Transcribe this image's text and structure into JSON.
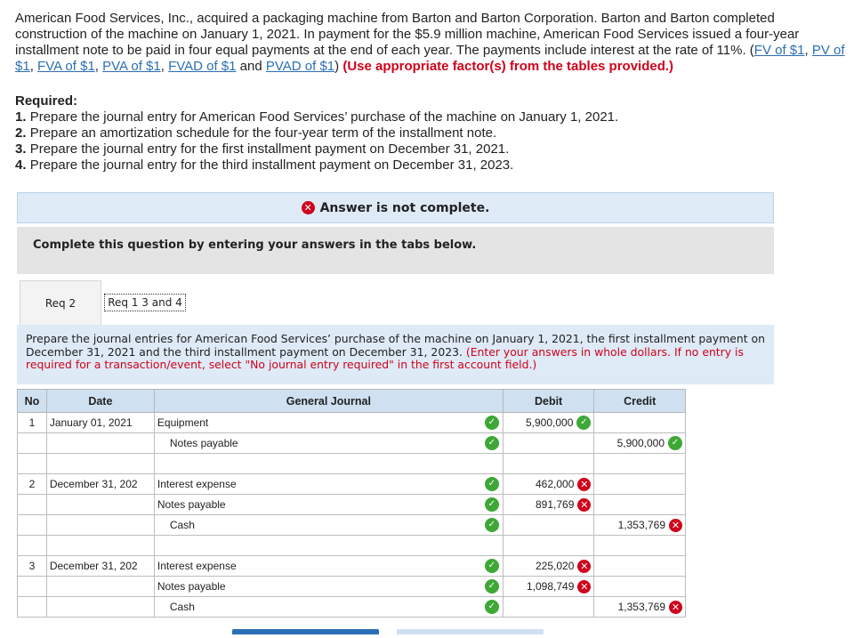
{
  "problem": {
    "text": "American Food Services, Inc., acquired a packaging machine from Barton and Barton Corporation. Barton and Barton completed construction of the machine on January 1, 2021. In payment for the $5.9 million machine, American Food Services issued a four-year installment note to be paid in four equal payments at the end of each year. The payments include interest at the rate of 11%. (",
    "links": [
      "FV of $1",
      "PV of $1",
      "FVA of $1",
      "PVA of $1",
      "FVAD of $1",
      "PVAD of $1"
    ],
    "link_sep": ", ",
    "link_and": " and ",
    "close_paren": ")",
    "instruction": "(Use appropriate factor(s) from the tables provided.)"
  },
  "required": {
    "heading": "Required:",
    "items": [
      {
        "num": "1.",
        "text": "Prepare the journal entry for American Food Services’ purchase of the machine on January 1, 2021."
      },
      {
        "num": "2.",
        "text": "Prepare an amortization schedule for the four-year term of the installment note."
      },
      {
        "num": "3.",
        "text": "Prepare the journal entry for the first installment payment on December 31, 2021."
      },
      {
        "num": "4.",
        "text": "Prepare the journal entry for the third installment payment on December 31, 2023."
      }
    ]
  },
  "banner": {
    "text": "Answer is not complete."
  },
  "instructions_box": {
    "text": "Complete this question by entering your answers in the tabs below."
  },
  "tabs": [
    {
      "label": "Req 2"
    },
    {
      "label": "Req 1 3 and 4"
    }
  ],
  "prompt": {
    "text": "Prepare the journal entries for American Food Services’ purchase of the machine on January 1, 2021, the first installment payment on December 31, 2021 and the third installment payment on December 31, 2023.",
    "red": "(Enter your answers in whole dollars. If no entry is required for a transaction/event, select \"No journal entry required\" in the first account field.)"
  },
  "journal": {
    "headers": {
      "no": "No",
      "date": "Date",
      "account": "General Journal",
      "debit": "Debit",
      "credit": "Credit"
    },
    "rows": [
      {
        "no": "1",
        "date": "January 01, 2021",
        "account": "Equipment",
        "indent": false,
        "acct_mark": "check",
        "debit": "5,900,000",
        "debit_mark": "check",
        "credit": "",
        "credit_mark": ""
      },
      {
        "no": "",
        "date": "",
        "account": "Notes payable",
        "indent": true,
        "acct_mark": "check",
        "debit": "",
        "debit_mark": "",
        "credit": "5,900,000",
        "credit_mark": "check"
      },
      {
        "no": "",
        "date": "",
        "account": "",
        "indent": false,
        "acct_mark": "",
        "debit": "",
        "debit_mark": "",
        "credit": "",
        "credit_mark": ""
      },
      {
        "no": "2",
        "date": "December 31, 202",
        "account": "Interest expense",
        "indent": false,
        "acct_mark": "check",
        "debit": "462,000",
        "debit_mark": "x",
        "credit": "",
        "credit_mark": ""
      },
      {
        "no": "",
        "date": "",
        "account": "Notes payable",
        "indent": false,
        "acct_mark": "check",
        "debit": "891,769",
        "debit_mark": "x",
        "credit": "",
        "credit_mark": ""
      },
      {
        "no": "",
        "date": "",
        "account": "Cash",
        "indent": true,
        "acct_mark": "check",
        "debit": "",
        "debit_mark": "",
        "credit": "1,353,769",
        "credit_mark": "x"
      },
      {
        "no": "",
        "date": "",
        "account": "",
        "indent": false,
        "acct_mark": "",
        "debit": "",
        "debit_mark": "",
        "credit": "",
        "credit_mark": ""
      },
      {
        "no": "3",
        "date": "December 31, 202",
        "account": "Interest expense",
        "indent": false,
        "acct_mark": "check",
        "debit": "225,020",
        "debit_mark": "x",
        "credit": "",
        "credit_mark": ""
      },
      {
        "no": "",
        "date": "",
        "account": "Notes payable",
        "indent": false,
        "acct_mark": "check",
        "debit": "1,098,749",
        "debit_mark": "x",
        "credit": "",
        "credit_mark": ""
      },
      {
        "no": "",
        "date": "",
        "account": "Cash",
        "indent": true,
        "acct_mark": "check",
        "debit": "",
        "debit_mark": "",
        "credit": "1,353,769",
        "credit_mark": "x"
      }
    ]
  },
  "colors": {
    "check": "#3ea836",
    "x": "#d0021b",
    "link": "#2a6fb5",
    "header_bg": "#cfe0f1"
  }
}
